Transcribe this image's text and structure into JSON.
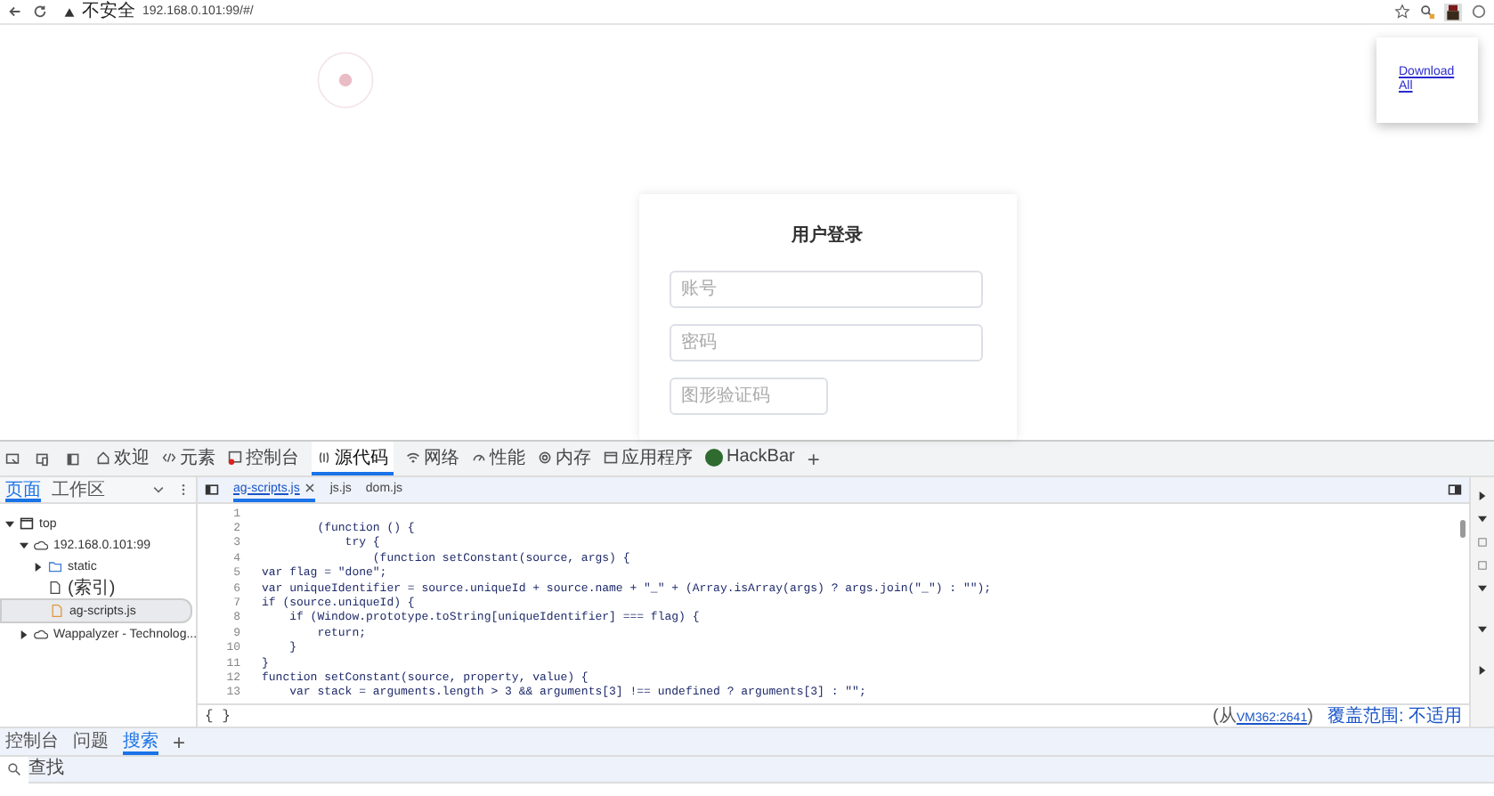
{
  "browser": {
    "security": "不安全",
    "url": "192.168.0.101:99/#/"
  },
  "popup": {
    "link": "Download All"
  },
  "login": {
    "title": "用户登录",
    "fields": [
      {
        "kind": "wide",
        "placeholder": "账号"
      },
      {
        "kind": "wide",
        "placeholder": "密码"
      },
      {
        "kind": "narrow",
        "placeholder": "图形验证码"
      }
    ]
  },
  "devtools": {
    "toolbar": [
      {
        "kind": "welcome",
        "label": "欢迎",
        "selected": false
      },
      {
        "kind": "elements",
        "label": "元素",
        "selected": false
      },
      {
        "kind": "console",
        "label": "控制台",
        "selected": false
      },
      {
        "kind": "sources",
        "label": "源代码",
        "selected": true
      },
      {
        "kind": "network",
        "label": "网络",
        "selected": false
      },
      {
        "kind": "performance",
        "label": "性能",
        "selected": false
      },
      {
        "kind": "memory",
        "label": "内存",
        "selected": false
      },
      {
        "kind": "application",
        "label": "应用程序",
        "selected": false
      },
      {
        "kind": "hackbar",
        "label": "HackBar",
        "selected": false
      }
    ],
    "add_tab": "+",
    "navigator_tabs": [
      {
        "label": "页面",
        "selected": true
      },
      {
        "label": "工作区",
        "selected": false
      }
    ],
    "tree": [
      {
        "kind": "frame",
        "label": "top",
        "expanded": true,
        "children": [
          {
            "kind": "cloud",
            "label": "192.168.0.101:99",
            "expanded": true,
            "children": [
              {
                "kind": "folder",
                "label": "static",
                "expanded": false,
                "selected": false
              },
              {
                "kind": "file",
                "label": "(索引)",
                "selected": false
              },
              {
                "kind": "script",
                "label": "ag-scripts.js",
                "selected": true
              }
            ]
          },
          {
            "kind": "cloud",
            "label": "Wappalyzer - Technolog...",
            "expanded": false
          }
        ]
      }
    ],
    "file_tabs": [
      {
        "label": "ag-scripts.js",
        "selected": true,
        "closable": true
      },
      {
        "label": "js.js",
        "selected": false,
        "closable": false
      },
      {
        "label": "dom.js",
        "selected": false,
        "closable": false
      }
    ],
    "code_lines": [
      {
        "number": "1"
      },
      {
        "number": "2",
        "text": "        (function () {"
      },
      {
        "number": "3",
        "text": "            try {"
      },
      {
        "number": "4",
        "text": "                (function setConstant(source, args) {"
      },
      {
        "number": "5",
        "text": "var flag = \"done\";"
      },
      {
        "number": "6",
        "text": "var uniqueIdentifier = source.uniqueId + source.name + \"_\" + (Array.isArray(args) ? args.join(\"_\") : \"\");"
      },
      {
        "number": "7",
        "text": "if (source.uniqueId) {"
      },
      {
        "number": "8",
        "text": "    if (Window.prototype.toString[uniqueIdentifier] === flag) {"
      },
      {
        "number": "9",
        "text": "        return;"
      },
      {
        "number": "10",
        "text": "    }"
      },
      {
        "number": "11",
        "text": "}"
      },
      {
        "number": "12",
        "text": "function setConstant(source, property, value) {"
      },
      {
        "number": "13",
        "text": "    var stack = arguments.length > 3 && arguments[3] !== undefined ? arguments[3] : \"\";"
      }
    ],
    "format_button": "{ }",
    "status": {
      "before": "(从",
      "link": "VM362:2641",
      "after": ")",
      "coverage": "覆盖范围: 不适用"
    },
    "drawer_tabs": [
      {
        "label": "控制台",
        "selected": false
      },
      {
        "label": "问题",
        "selected": false
      },
      {
        "label": "搜索",
        "selected": true
      }
    ],
    "drawer_add_tab": "+",
    "search": {
      "placeholder": "查找"
    }
  }
}
